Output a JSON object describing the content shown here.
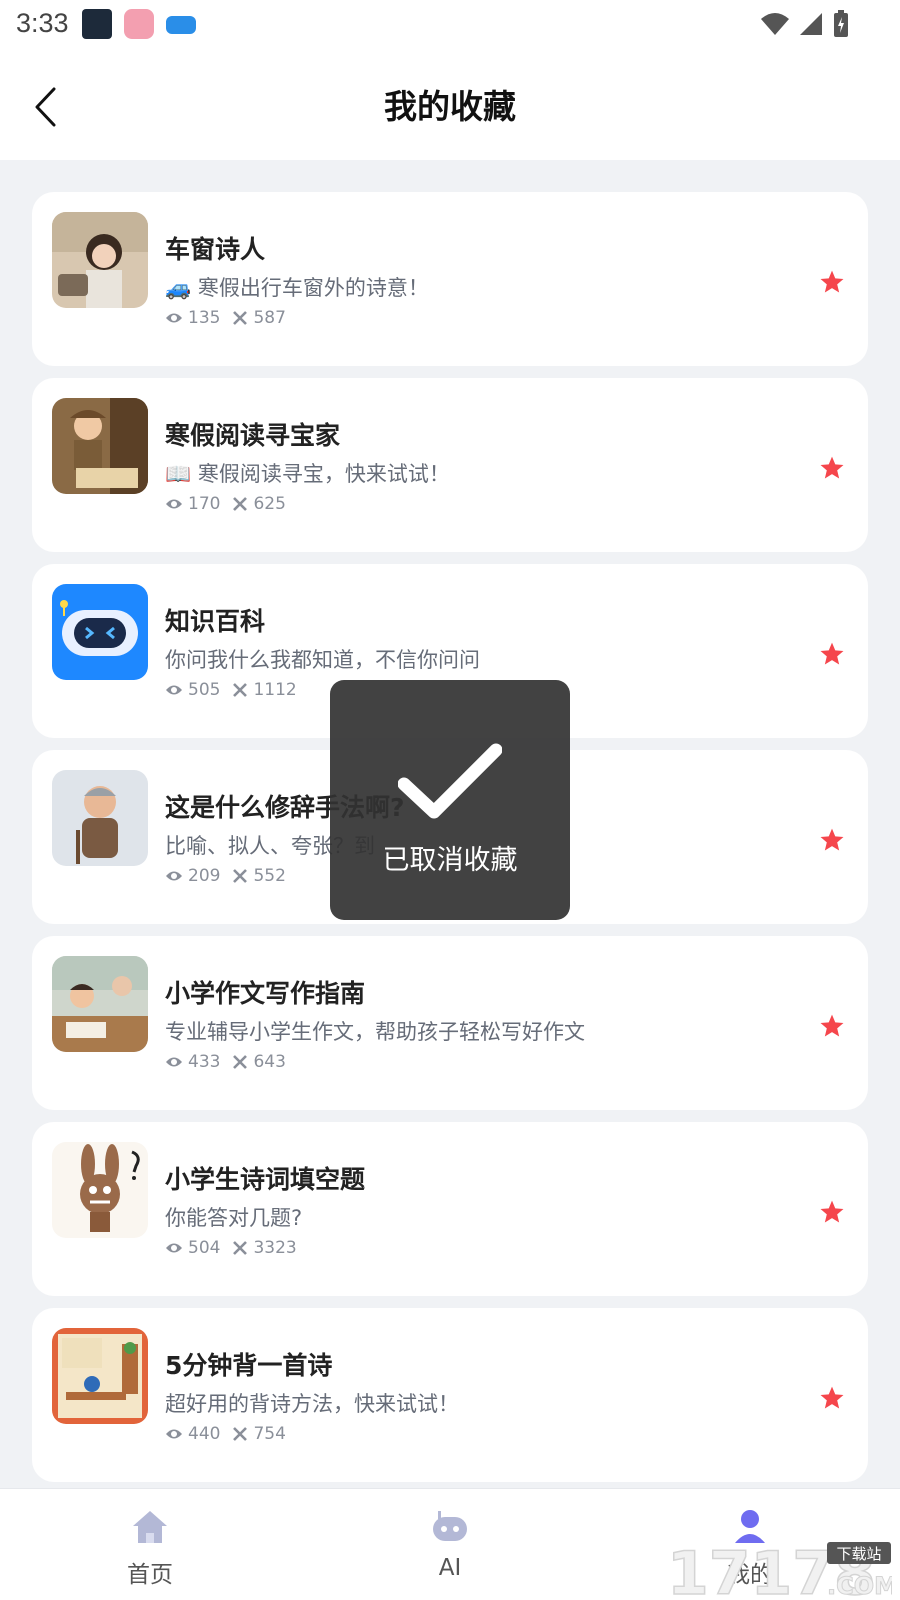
{
  "status_bar": {
    "time": "3:33"
  },
  "header": {
    "title": "我的收藏"
  },
  "items": [
    {
      "title": "车窗诗人",
      "emoji": "🚙",
      "desc": "寒假出行车窗外的诗意！",
      "views": "135",
      "uses": "587"
    },
    {
      "title": "寒假阅读寻宝家",
      "emoji": "📖",
      "desc": "寒假阅读寻宝，快来试试！",
      "views": "170",
      "uses": "625"
    },
    {
      "title": "知识百科",
      "emoji": "",
      "desc": "你问我什么我都知道，不信你问问",
      "views": "505",
      "uses": "1112"
    },
    {
      "title": "这是什么修辞手法啊?",
      "emoji": "",
      "desc": "比喻、拟人、夸张？到",
      "views": "209",
      "uses": "552"
    },
    {
      "title": "小学作文写作指南",
      "emoji": "",
      "desc": "专业辅导小学生作文，帮助孩子轻松写好作文",
      "views": "433",
      "uses": "643"
    },
    {
      "title": "小学生诗词填空题",
      "emoji": "",
      "desc": "你能答对几题?",
      "views": "504",
      "uses": "3323"
    },
    {
      "title": "5分钟背一首诗",
      "emoji": "",
      "desc": "超好用的背诗方法，快来试试！",
      "views": "440",
      "uses": "754"
    }
  ],
  "toast": {
    "text": "已取消收藏"
  },
  "tabs": [
    {
      "label": "首页"
    },
    {
      "label": "AI"
    },
    {
      "label": "我的"
    }
  ],
  "watermark": {
    "text": "17178",
    "sub": "下载站",
    "suffix": ".COM"
  },
  "colors": {
    "star": "#f5464c",
    "tab_icon": "#b3b8d6",
    "active_tab_icon": "#6f6cf0",
    "robot_blue": "#1e88ff"
  }
}
